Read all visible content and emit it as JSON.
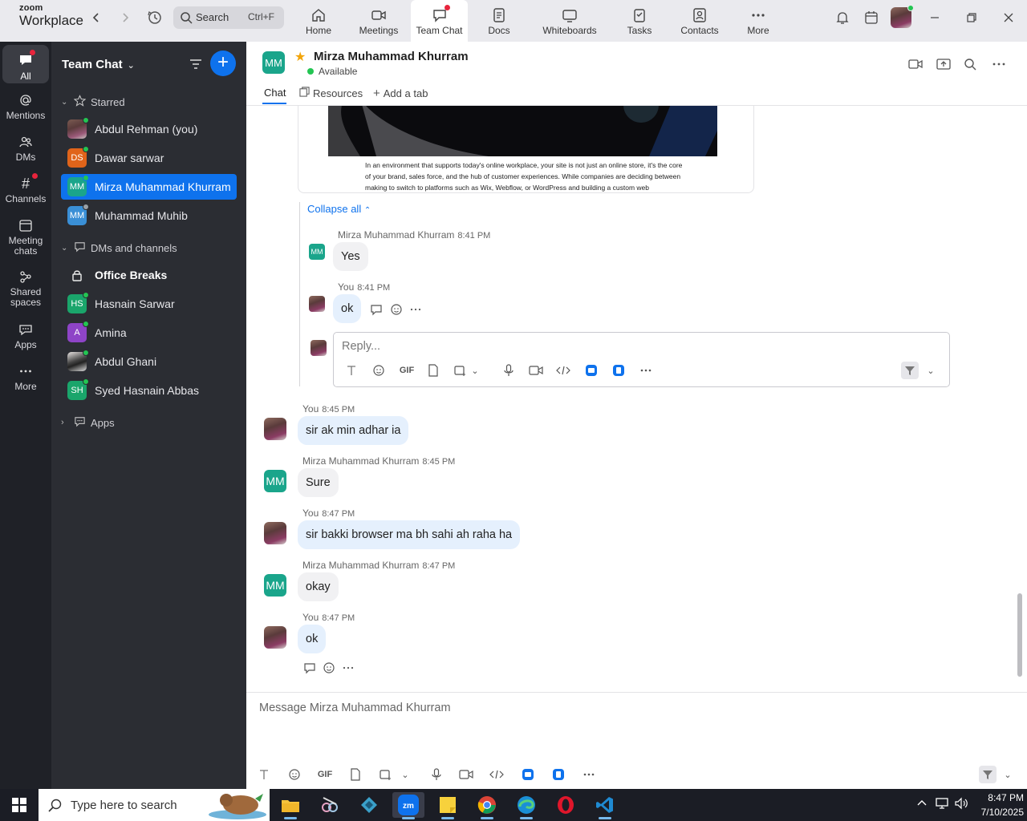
{
  "app": {
    "logo_top": "zoom",
    "logo_bottom": "Workplace",
    "search_label": "Search",
    "search_shortcut": "Ctrl+F",
    "nav": [
      {
        "label": "Home"
      },
      {
        "label": "Meetings"
      },
      {
        "label": "Team Chat"
      },
      {
        "label": "Docs"
      },
      {
        "label": "Whiteboards"
      },
      {
        "label": "Tasks"
      },
      {
        "label": "Contacts"
      },
      {
        "label": "More"
      }
    ]
  },
  "rail": [
    {
      "label": "All"
    },
    {
      "label": "Mentions"
    },
    {
      "label": "DMs"
    },
    {
      "label": "Channels"
    },
    {
      "label": "Meeting chats"
    },
    {
      "label": "Shared spaces"
    },
    {
      "label": "Apps"
    },
    {
      "label": "More"
    }
  ],
  "sidebar": {
    "title": "Team Chat",
    "starred_label": "Starred",
    "dms_label": "DMs and channels",
    "apps_label": "Apps",
    "starred": [
      {
        "name": "Abdul Rehman (you)",
        "initials": "",
        "color": "#7b5b52"
      },
      {
        "name": "Dawar sarwar",
        "initials": "DS",
        "color": "#e0641a"
      },
      {
        "name": "Mirza Muhammad Khurram",
        "initials": "MM",
        "color": "#1aa58b"
      },
      {
        "name": "Muhammad Muhib",
        "initials": "MM",
        "color": "#3a8fd6"
      }
    ],
    "dms": [
      {
        "name": "Office Breaks",
        "initials": ""
      },
      {
        "name": "Hasnain Sarwar",
        "initials": "HS",
        "color": "#1aa56b"
      },
      {
        "name": "Amina",
        "initials": "A",
        "color": "#8e44c7"
      },
      {
        "name": "Abdul Ghani",
        "initials": ""
      },
      {
        "name": "Syed Hasnain Abbas",
        "initials": "SH",
        "color": "#1aa56b"
      }
    ]
  },
  "header": {
    "initials": "MM",
    "name": "Mirza Muhammad Khurram",
    "status": "Available",
    "tabs": [
      "Chat",
      "Resources",
      "Add a tab"
    ]
  },
  "card": {
    "text": "In an environment that supports today's online workplace, your site is not just an online store, it's the core of your brand, sales force, and the hub of customer experiences. While companies are deciding between making to switch to platforms such as Wix, Webflow, or WordPress and building a custom web"
  },
  "thread": {
    "collapse_label": "Collapse all",
    "messages": [
      {
        "author": "Mirza Muhammad Khurram",
        "time": "8:41 PM",
        "text": "Yes",
        "initials": "MM"
      },
      {
        "author": "You",
        "time": "8:41 PM",
        "text": "ok"
      }
    ],
    "reply_placeholder": "Reply...",
    "gif_label": "GIF"
  },
  "messages": [
    {
      "author": "You",
      "time": "8:45 PM",
      "text": "sir ak min adhar ia"
    },
    {
      "author": "Mirza Muhammad Khurram",
      "time": "8:45 PM",
      "text": "Sure",
      "initials": "MM"
    },
    {
      "author": "You",
      "time": "8:47 PM",
      "text": "sir bakki browser ma bh sahi ah raha ha"
    },
    {
      "author": "Mirza Muhammad Khurram",
      "time": "8:47 PM",
      "text": "okay",
      "initials": "MM"
    },
    {
      "author": "You",
      "time": "8:47 PM",
      "text": "ok"
    }
  ],
  "composer": {
    "placeholder": "Message Mirza Muhammad Khurram",
    "gif_label": "GIF"
  },
  "taskbar": {
    "search_placeholder": "Type here to search",
    "time": "8:47 PM",
    "date": "7/10/2025"
  },
  "colors": {
    "accent": "#0e72ed",
    "online": "#23c552",
    "notify": "#e8243c",
    "avatar_mm": "#1aa58b"
  }
}
